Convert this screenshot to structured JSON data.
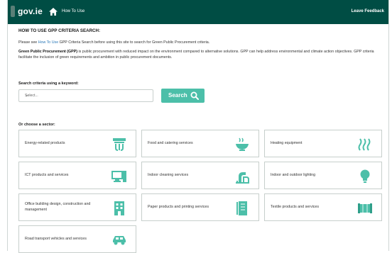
{
  "header": {
    "brand": "gov.ie",
    "nav_link": "How To Use",
    "feedback": "Leave Feedback"
  },
  "page": {
    "title": "HOW TO USE GPP CRITERIA SEARCH:",
    "intro_prefix": "Please see ",
    "intro_link": "How To Use",
    "intro_suffix": " GPP Criteria Search before using this site to search for Green Public Procurement criteria.",
    "gpp_bold": "Green Public Procurement (GPP)",
    "gpp_text": " is public procurement with reduced impact on the environment compared to alternative solutions. GPP can help address environmental and climate action objectives. GPP criteria facilitate the inclusion of green requirements and ambition in public procurement documents."
  },
  "search": {
    "label": "Search criteria using a keyword:",
    "placeholder": "Select...",
    "button": "Search"
  },
  "sectors": {
    "label": "Or choose a sector:",
    "items": [
      {
        "label": "Energy-related products",
        "icon": "energy-products-icon"
      },
      {
        "label": "Food and catering services",
        "icon": "food-catering-icon"
      },
      {
        "label": "Heating equipment",
        "icon": "heating-icon"
      },
      {
        "label": "ICT products and services",
        "icon": "ict-icon"
      },
      {
        "label": "Indoor cleaning services",
        "icon": "cleaning-icon"
      },
      {
        "label": "Indoor and outdoor lighting",
        "icon": "lightbulb-icon"
      },
      {
        "label": "Office building design, construction and management",
        "icon": "office-building-icon"
      },
      {
        "label": "Paper products and printing services",
        "icon": "paper-icon"
      },
      {
        "label": "Textile products and services",
        "icon": "textile-icon"
      },
      {
        "label": "Road transport vehicles and services",
        "icon": "car-icon"
      }
    ]
  },
  "colors": {
    "header_bg": "#004d44",
    "accent": "#4cbfa9",
    "link": "#2a78b8"
  }
}
